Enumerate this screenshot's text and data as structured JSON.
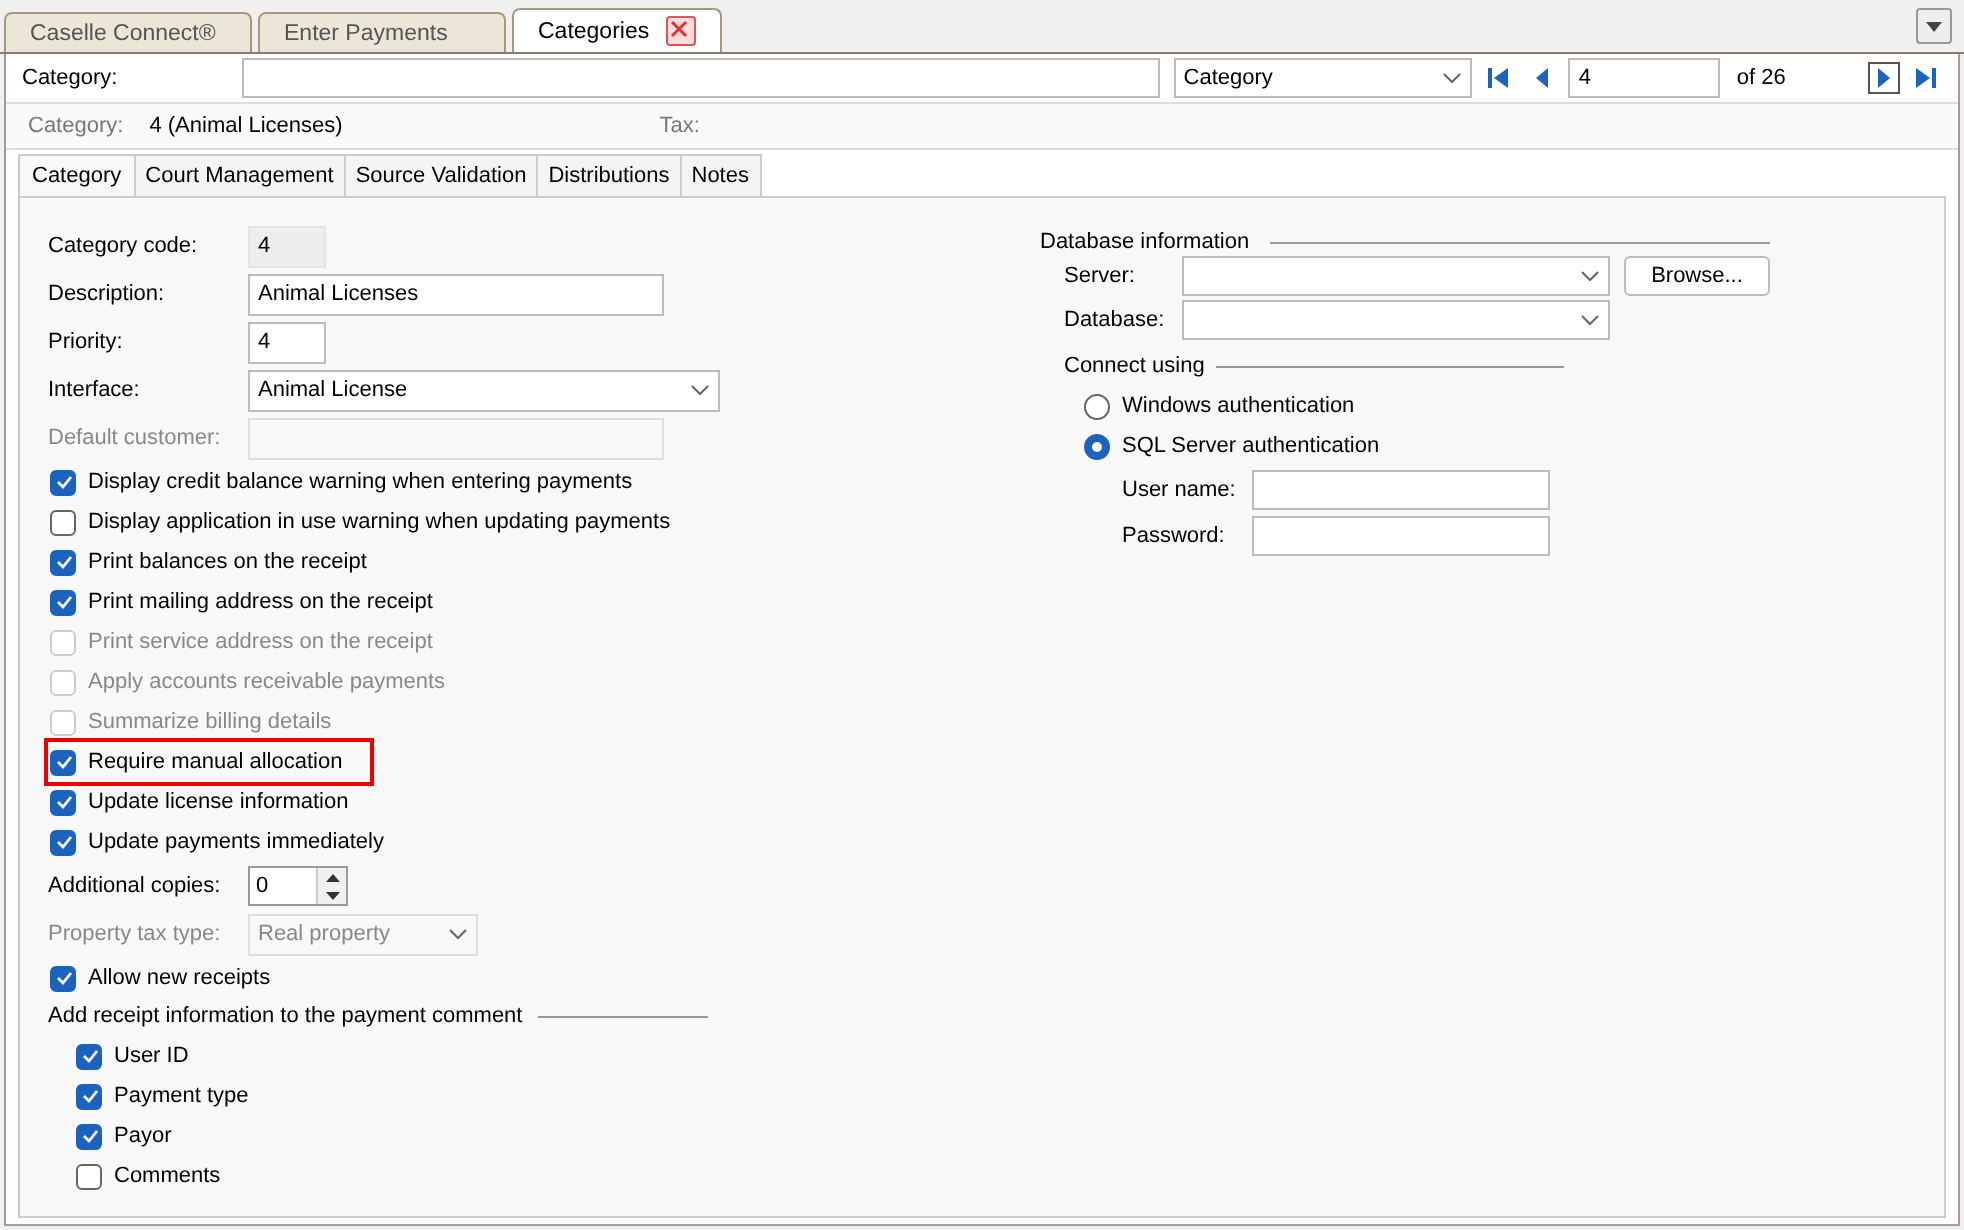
{
  "doc_tabs": [
    {
      "label": "Caselle Connect®",
      "selected": false,
      "closable": false
    },
    {
      "label": "Enter Payments",
      "selected": false,
      "closable": false
    },
    {
      "label": "Categories",
      "selected": true,
      "closable": true
    }
  ],
  "toolbar": {
    "label": "Category:",
    "filter": "Category",
    "record": "4",
    "of": "of 26"
  },
  "info": {
    "category_label": "Category:",
    "category_value": "4 (Animal Licenses)",
    "tax_label": "Tax:"
  },
  "tabs": [
    {
      "label": "Category",
      "selected": true
    },
    {
      "label": "Court Management",
      "selected": false
    },
    {
      "label": "Source Validation",
      "selected": false
    },
    {
      "label": "Distributions",
      "selected": false
    },
    {
      "label": "Notes",
      "selected": false
    }
  ],
  "left": [
    {
      "kind": "readonly",
      "label": "Category code:",
      "value": "4",
      "disabled": false
    },
    {
      "kind": "text",
      "label": "Description:",
      "value": "Animal Licenses",
      "disabled": false
    },
    {
      "kind": "text",
      "label": "Priority:",
      "value": "4",
      "disabled": false
    },
    {
      "kind": "dropdown",
      "label": "Interface:",
      "value": "Animal License",
      "disabled": false
    },
    {
      "kind": "text",
      "label": "Default customer:",
      "disabled": true
    },
    {
      "kind": "checkbox",
      "label": "Display credit balance warning when entering payments",
      "checked": true,
      "disabled": false,
      "highlighted": false
    },
    {
      "kind": "checkbox",
      "label": "Display application in use warning when updating payments",
      "checked": false,
      "disabled": false,
      "highlighted": false
    },
    {
      "kind": "checkbox",
      "label": "Print balances on the receipt",
      "checked": true,
      "disabled": false,
      "highlighted": false
    },
    {
      "kind": "checkbox",
      "label": "Print mailing address on the receipt",
      "checked": true,
      "disabled": false,
      "highlighted": false
    },
    {
      "kind": "checkbox",
      "label": "Print service address on the receipt",
      "checked": false,
      "disabled": true,
      "highlighted": false
    },
    {
      "kind": "checkbox",
      "label": "Apply accounts receivable payments",
      "checked": false,
      "disabled": true,
      "highlighted": false
    },
    {
      "kind": "checkbox",
      "label": "Summarize billing details",
      "checked": false,
      "disabled": true,
      "highlighted": false
    },
    {
      "kind": "checkbox",
      "label": "Require manual allocation",
      "checked": true,
      "disabled": false,
      "highlighted": true
    },
    {
      "kind": "checkbox",
      "label": "Update license information",
      "checked": true,
      "disabled": false,
      "highlighted": false
    },
    {
      "kind": "checkbox",
      "label": "Update payments immediately",
      "checked": true,
      "disabled": false,
      "highlighted": false
    },
    {
      "kind": "spin",
      "label": "Additional copies:",
      "value": "0",
      "disabled": false
    },
    {
      "kind": "dropdown",
      "label": "Property tax type:",
      "value": "Real property",
      "disabled": true
    },
    {
      "kind": "checkbox",
      "label": "Allow new receipts",
      "checked": true,
      "disabled": false,
      "highlighted": false
    },
    {
      "kind": "group",
      "label": "Add receipt information to the payment comment",
      "items": [
        {
          "label": "User ID",
          "checked": true
        },
        {
          "label": "Payment type",
          "checked": true
        },
        {
          "label": "Payor",
          "checked": true
        },
        {
          "label": "Comments",
          "checked": false
        }
      ]
    }
  ],
  "database": {
    "heading": "Database information",
    "server_label": "Server:",
    "browse": "Browse...",
    "database_label": "Database:",
    "connect_heading": "Connect using",
    "auth": [
      {
        "label": "Windows authentication",
        "selected": false
      },
      {
        "label": "SQL Server authentication",
        "selected": true
      }
    ],
    "user_label": "User name:",
    "password_label": "Password:"
  }
}
